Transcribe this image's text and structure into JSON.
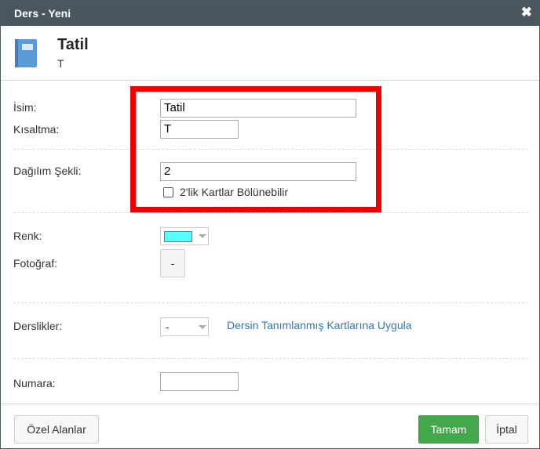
{
  "dialog": {
    "title": "Ders - Yeni",
    "close_icon": "close-x-icon"
  },
  "header": {
    "icon": "book-icon",
    "name": "Tatil",
    "abbreviation": "T"
  },
  "form": {
    "name_label": "İsim:",
    "name_value": "Tatil",
    "abbr_label": "Kısaltma:",
    "abbr_value": "T",
    "distribution_label": "Dağılım Şekli:",
    "distribution_value": "2",
    "divisible_cards_label": "2'lik Kartlar Bölünebilir",
    "divisible_cards_checked": false,
    "color_label": "Renk:",
    "color_value": "#55ffff",
    "photo_label": "Fotoğraf:",
    "photo_button": "-",
    "classrooms_label": "Derslikler:",
    "classrooms_value": "-",
    "apply_link": "Dersin Tanımlanmış Kartlarına Uygula",
    "number_label": "Numara:",
    "number_value": ""
  },
  "footer": {
    "custom_fields_button": "Özel Alanlar",
    "ok_button": "Tamam",
    "cancel_button": "İptal"
  },
  "colors": {
    "titlebar": "#4a575e",
    "ok_button": "#43a84a",
    "link": "#2a7ab8",
    "highlight_box": "#ee0000",
    "book_icon": "#5b9bd5"
  }
}
